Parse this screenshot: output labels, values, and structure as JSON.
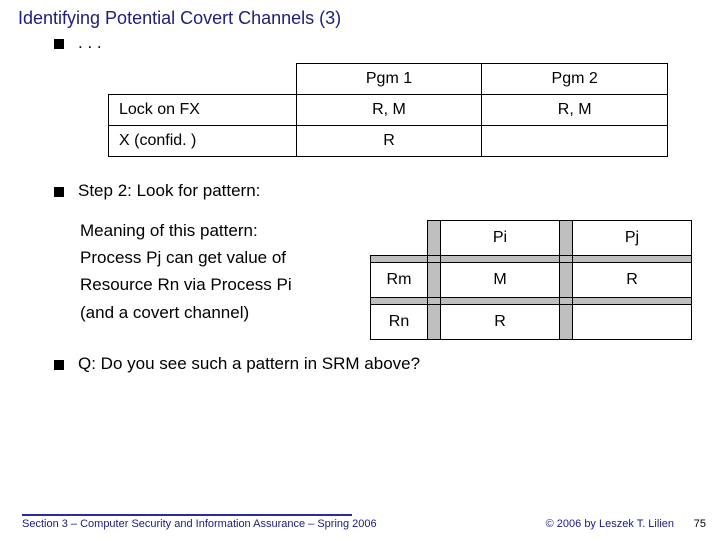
{
  "title": "Identifying Potential Covert Channels (3)",
  "ellipsis": ". . .",
  "table1": {
    "cols": [
      "Pgm 1",
      "Pgm 2"
    ],
    "rows": [
      {
        "label": "Lock on FX",
        "c1": "R, M",
        "c2": "R, M"
      },
      {
        "label": "X (confid. )",
        "c1": "R",
        "c2": ""
      }
    ]
  },
  "step": "Step 2: Look for pattern:",
  "meaning": {
    "l1": "Meaning of this pattern:",
    "l2": "Process Pj can get value of",
    "l3": "Resource Rn via Process Pi",
    "l4": "(and a covert channel)"
  },
  "pattern": {
    "col1": "Pi",
    "col2": "Pj",
    "row1": "Rm",
    "row2": "Rn",
    "a11": "M",
    "a12": "R",
    "a21": "R",
    "a22": ""
  },
  "question": "Q: Do you see such a pattern in SRM above?",
  "footer": {
    "left": "Section 3 – Computer Security and Information Assurance – Spring 2006",
    "right": "© 2006 by Leszek T. Lilien"
  },
  "page": "75"
}
